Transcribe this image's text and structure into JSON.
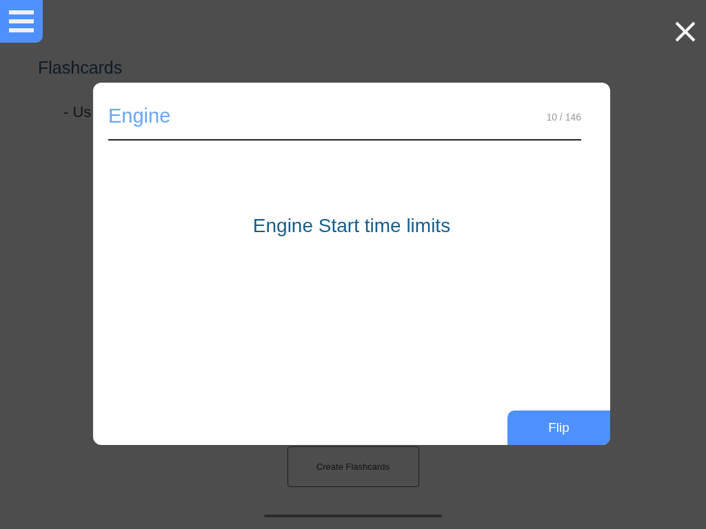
{
  "page": {
    "title": "Flashcards",
    "intro_text": "- Us",
    "create_button": "Create Flashcards"
  },
  "flashcard_dialog": {
    "category": "Engine",
    "counter": "10 / 146",
    "prompt": "Engine Start time limits",
    "flip_button": "Flip"
  }
}
